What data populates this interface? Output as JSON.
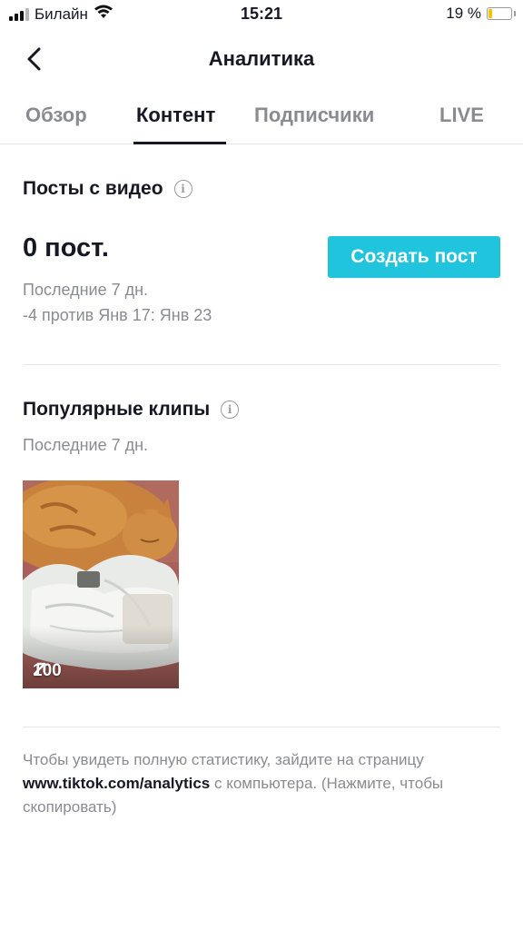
{
  "status_bar": {
    "carrier": "Билайн",
    "time": "15:21",
    "battery_percent": "19 %",
    "battery_level": 0.19,
    "battery_color": "#f5c400"
  },
  "header": {
    "title": "Аналитика",
    "back_icon": "chevron-left-icon"
  },
  "tabs": [
    {
      "label": "Обзор",
      "active": false
    },
    {
      "label": "Контент",
      "active": true
    },
    {
      "label": "Подписчики",
      "active": false
    },
    {
      "label": "LIVE",
      "active": false
    }
  ],
  "posts_section": {
    "title": "Посты с видео",
    "info_icon": "info-icon",
    "count": "0 пост.",
    "period": "Последние 7 дн.",
    "comparison": "-4 против Янв 17: Янв 23",
    "create_button": "Создать пост",
    "accent_color": "#20c4dc"
  },
  "popular_section": {
    "title": "Популярные клипы",
    "info_icon": "info-icon",
    "period": "Последние 7 дн.",
    "clips": [
      {
        "views": "100",
        "views_icon": "trend-arrow-icon"
      }
    ]
  },
  "footer": {
    "text_before": "Чтобы увидеть полную статистику, зайдите на страницу ",
    "link": "www.tiktok.com/analytics",
    "text_after": " с компьютера. (Нажмите, чтобы скопировать)"
  }
}
